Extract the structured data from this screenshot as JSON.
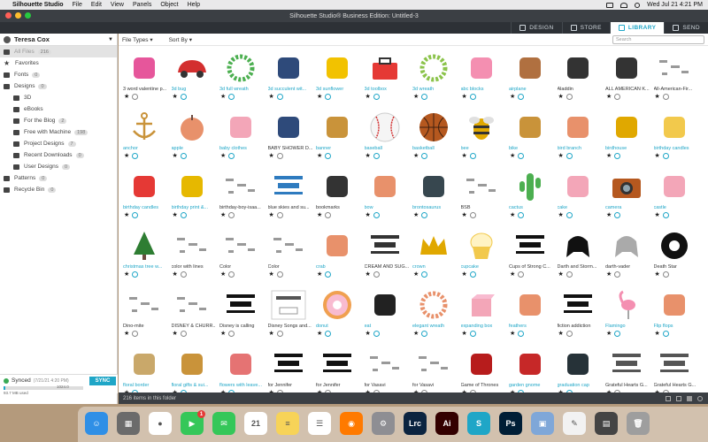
{
  "menubar": {
    "app_name": "Silhouette Studio",
    "items": [
      "File",
      "Edit",
      "View",
      "Panels",
      "Object",
      "Help"
    ],
    "clock": "Wed Jul 21  4:21 PM"
  },
  "window": {
    "title": "Silhouette Studio® Business Edition: Untitled-3"
  },
  "tabs": [
    {
      "label": "DESIGN",
      "active": false,
      "icon": "design-icon"
    },
    {
      "label": "STORE",
      "active": false,
      "icon": "store-icon"
    },
    {
      "label": "LIBRARY",
      "active": true,
      "icon": "library-icon"
    },
    {
      "label": "SEND",
      "active": false,
      "icon": "send-icon"
    }
  ],
  "sidebar": {
    "user": "Teresa Cox",
    "items": [
      {
        "label": "All Files",
        "count": "216",
        "indent": false,
        "selected": true,
        "icon": "grid-icon"
      },
      {
        "label": "Favorites",
        "count": "",
        "indent": false,
        "selected": false,
        "icon": "star-icon"
      },
      {
        "label": "Fonts",
        "count": "0",
        "indent": false,
        "selected": false,
        "icon": "font-icon"
      },
      {
        "label": "Designs",
        "count": "0",
        "indent": false,
        "selected": false,
        "icon": "folder-icon"
      },
      {
        "label": "3D",
        "count": "",
        "indent": true,
        "selected": false,
        "icon": "folder-icon"
      },
      {
        "label": "eBooks",
        "count": "",
        "indent": true,
        "selected": false,
        "icon": "folder-icon"
      },
      {
        "label": "For the Blog",
        "count": "2",
        "indent": true,
        "selected": false,
        "icon": "folder-icon"
      },
      {
        "label": "Free with Machine",
        "count": "198",
        "indent": true,
        "selected": false,
        "icon": "folder-icon"
      },
      {
        "label": "Project Designs",
        "count": "7",
        "indent": true,
        "selected": false,
        "icon": "folder-icon"
      },
      {
        "label": "Recent Downloads",
        "count": "0",
        "indent": true,
        "selected": false,
        "icon": "folder-icon"
      },
      {
        "label": "User Designs",
        "count": "0",
        "indent": true,
        "selected": false,
        "icon": "folder-icon"
      },
      {
        "label": "Patterns",
        "count": "0",
        "indent": false,
        "selected": false,
        "icon": "pattern-icon"
      },
      {
        "label": "Recycle Bin",
        "count": "0",
        "indent": false,
        "selected": false,
        "icon": "trash-icon"
      }
    ],
    "sync": {
      "status": "Synced",
      "when": "(7/21/21 4:20 PM)",
      "used_fraction": 0.02,
      "used_text": "93.7 MB used",
      "capacity": "1024.0",
      "button": "SYNC"
    }
  },
  "library": {
    "file_types_label": "File Types",
    "sort_by_label": "Sort By",
    "search_placeholder": "Search",
    "footer": "216 items in this folder",
    "rows": [
      [
        {
          "label": "3 word valentine p...",
          "cloud": false,
          "icon": "valentine-words-icon",
          "color": "#e6569b"
        },
        {
          "label": "3d bug",
          "cloud": true,
          "icon": "car-icon",
          "color": "#d32f2f"
        },
        {
          "label": "3d full wreath",
          "cloud": true,
          "icon": "wreath-icon",
          "color": "#4caf50"
        },
        {
          "label": "3d succulent wit...",
          "cloud": true,
          "icon": "succulent-icon",
          "color": "#2e4a7a"
        },
        {
          "label": "3d sunflower",
          "cloud": true,
          "icon": "sunflower-icon",
          "color": "#f2c200"
        },
        {
          "label": "3d toolbox",
          "cloud": true,
          "icon": "toolbox-icon",
          "color": "#e53935"
        },
        {
          "label": "3d wreath",
          "cloud": true,
          "icon": "wreath-icon",
          "color": "#8bc34a"
        },
        {
          "label": "abc blocks",
          "cloud": true,
          "icon": "blocks-icon",
          "color": "#f48fb1"
        },
        {
          "label": "airplane",
          "cloud": true,
          "icon": "airplane-icon",
          "color": "#b07040"
        },
        {
          "label": "Aladdin",
          "cloud": false,
          "icon": "globe-icon",
          "color": "#333333"
        },
        {
          "label": "ALL AMERICAN K...",
          "cloud": false,
          "icon": "splash-icon",
          "color": "#333333"
        },
        {
          "label": "All-American-Fir...",
          "cloud": false,
          "icon": "sketch-icon",
          "color": "#999999"
        }
      ],
      [
        {
          "label": "anchor",
          "cloud": true,
          "icon": "anchor-icon",
          "color": "#c9933a"
        },
        {
          "label": "apple",
          "cloud": true,
          "icon": "apple-icon",
          "color": "#e8916b"
        },
        {
          "label": "baby clothes",
          "cloud": true,
          "icon": "onesie-icon",
          "color": "#f3a6b8"
        },
        {
          "label": "BABY SHOWER D...",
          "cloud": false,
          "icon": "flag-icon",
          "color": "#2e4a7a"
        },
        {
          "label": "banner",
          "cloud": true,
          "icon": "banner-icon",
          "color": "#c9933a"
        },
        {
          "label": "baseball",
          "cloud": true,
          "icon": "baseball-icon",
          "color": "#d32f2f"
        },
        {
          "label": "basketball",
          "cloud": true,
          "icon": "basketball-icon",
          "color": "#b5581f"
        },
        {
          "label": "bee",
          "cloud": true,
          "icon": "bee-icon",
          "color": "#e0a800"
        },
        {
          "label": "bike",
          "cloud": true,
          "icon": "bike-icon",
          "color": "#c9933a"
        },
        {
          "label": "bird branch",
          "cloud": true,
          "icon": "branch-icon",
          "color": "#e8916b"
        },
        {
          "label": "birdhouse",
          "cloud": true,
          "icon": "birdhouse-icon",
          "color": "#e0a800"
        },
        {
          "label": "birthday candles",
          "cloud": true,
          "icon": "box-icon",
          "color": "#f2c94c"
        }
      ],
      [
        {
          "label": "birthday candles",
          "cloud": true,
          "icon": "candles-icon",
          "color": "#e53935"
        },
        {
          "label": "birthday print &...",
          "cloud": true,
          "icon": "girl-icon",
          "color": "#e6b800"
        },
        {
          "label": "birthday-boy-isaa...",
          "cloud": false,
          "icon": "sketch-icon",
          "color": "#999999"
        },
        {
          "label": "blue skies and su...",
          "cloud": false,
          "icon": "text-art-icon",
          "color": "#2e7bbf"
        },
        {
          "label": "bookmarks",
          "cloud": false,
          "icon": "bookmark-icon",
          "color": "#333333"
        },
        {
          "label": "bow",
          "cloud": true,
          "icon": "bow-icon",
          "color": "#e8916b"
        },
        {
          "label": "brontosaurus",
          "cloud": true,
          "icon": "dinosaur-icon",
          "color": "#37474f"
        },
        {
          "label": "BSB",
          "cloud": false,
          "icon": "sketch-icon",
          "color": "#999999"
        },
        {
          "label": "cactus",
          "cloud": true,
          "icon": "cactus-icon",
          "color": "#4caf50"
        },
        {
          "label": "cake",
          "cloud": true,
          "icon": "cake-icon",
          "color": "#f3a6b8"
        },
        {
          "label": "camera",
          "cloud": true,
          "icon": "camera-icon",
          "color": "#b5581f"
        },
        {
          "label": "castle",
          "cloud": true,
          "icon": "castle-icon",
          "color": "#f3a6b8"
        }
      ],
      [
        {
          "label": "christmas tree w...",
          "cloud": true,
          "icon": "tree-icon",
          "color": "#2e7d32"
        },
        {
          "label": "color with lines",
          "cloud": false,
          "icon": "sketch-icon",
          "color": "#999999"
        },
        {
          "label": "Color",
          "cloud": false,
          "icon": "sketch-icon",
          "color": "#999999"
        },
        {
          "label": "Color",
          "cloud": false,
          "icon": "sketch-icon",
          "color": "#999999"
        },
        {
          "label": "crab",
          "cloud": true,
          "icon": "crab-icon",
          "color": "#e8916b"
        },
        {
          "label": "CREAM AND SUG...",
          "cloud": false,
          "icon": "text-art-icon",
          "color": "#333333"
        },
        {
          "label": "crown",
          "cloud": true,
          "icon": "crown-icon",
          "color": "#e0a800"
        },
        {
          "label": "cupcake",
          "cloud": true,
          "icon": "cupcake-icon",
          "color": "#f2c94c"
        },
        {
          "label": "Cups of Strong C...",
          "cloud": false,
          "icon": "text-art-icon",
          "color": "#111111"
        },
        {
          "label": "Darth and Storm...",
          "cloud": false,
          "icon": "helmet-icon",
          "color": "#111111"
        },
        {
          "label": "darth-vader",
          "cloud": false,
          "icon": "helmet-icon",
          "color": "#aaaaaa"
        },
        {
          "label": "Death Star",
          "cloud": false,
          "icon": "emblem-icon",
          "color": "#111111"
        }
      ],
      [
        {
          "label": "Dino-mite",
          "cloud": false,
          "icon": "sketch-icon",
          "color": "#999999"
        },
        {
          "label": "DISNEY & CHURR...",
          "cloud": false,
          "icon": "sketch-icon",
          "color": "#999999"
        },
        {
          "label": "Disney is calling",
          "cloud": false,
          "icon": "text-art-icon",
          "color": "#111111"
        },
        {
          "label": "Disney Songs and...",
          "cloud": false,
          "icon": "download-failed-icon",
          "color": "#555555"
        },
        {
          "label": "donut",
          "cloud": true,
          "icon": "donut-icon",
          "color": "#f0a050"
        },
        {
          "label": "eat",
          "cloud": true,
          "icon": "utensils-icon",
          "color": "#222222"
        },
        {
          "label": "elegant wreath",
          "cloud": true,
          "icon": "wreath-icon",
          "color": "#e8916b"
        },
        {
          "label": "expanding box",
          "cloud": true,
          "icon": "gift-box-icon",
          "color": "#f3a6b8"
        },
        {
          "label": "feathers",
          "cloud": true,
          "icon": "feather-icon",
          "color": "#e8916b"
        },
        {
          "label": "fiction addiction",
          "cloud": false,
          "icon": "text-art-icon",
          "color": "#111111"
        },
        {
          "label": "Flamingo",
          "cloud": true,
          "icon": "flamingo-icon",
          "color": "#f48fb1"
        },
        {
          "label": "Flip flops",
          "cloud": true,
          "icon": "flipflops-icon",
          "color": "#e8916b"
        }
      ],
      [
        {
          "label": "floral border",
          "cloud": true,
          "icon": "border-icon",
          "color": "#c9a86a"
        },
        {
          "label": "floral gifts & sui...",
          "cloud": true,
          "icon": "gifts-icon",
          "color": "#c9933a"
        },
        {
          "label": "flowers with leave...",
          "cloud": true,
          "icon": "flowers-icon",
          "color": "#e57373"
        },
        {
          "label": "for Jennifer",
          "cloud": false,
          "icon": "text-art-icon",
          "color": "#111111"
        },
        {
          "label": "for Jennifer",
          "cloud": false,
          "icon": "text-art-icon",
          "color": "#111111"
        },
        {
          "label": "for Vasavi",
          "cloud": false,
          "icon": "sketch-icon",
          "color": "#999999"
        },
        {
          "label": "for Vasavi",
          "cloud": false,
          "icon": "sketch-icon",
          "color": "#999999"
        },
        {
          "label": "Game of Thrones",
          "cloud": false,
          "icon": "flag-icon",
          "color": "#b71c1c"
        },
        {
          "label": "garden gnome",
          "cloud": true,
          "icon": "gnome-icon",
          "color": "#c62828"
        },
        {
          "label": "graduation cap",
          "cloud": true,
          "icon": "cap-icon",
          "color": "#263238"
        },
        {
          "label": "Grateful Hearts G...",
          "cloud": false,
          "icon": "text-art-icon",
          "color": "#555555"
        },
        {
          "label": "Grateful Hearts G...",
          "cloud": false,
          "icon": "text-art-icon",
          "color": "#555555"
        }
      ]
    ]
  },
  "dock": [
    {
      "name": "finder",
      "bg": "#2f8fe6",
      "glyph": "☺",
      "badge": ""
    },
    {
      "name": "launchpad",
      "bg": "#6b6b6b",
      "glyph": "▦",
      "badge": ""
    },
    {
      "name": "chrome",
      "bg": "#ffffff",
      "glyph": "●",
      "badge": ""
    },
    {
      "name": "facetime",
      "bg": "#35c759",
      "glyph": "▶",
      "badge": "1"
    },
    {
      "name": "messages",
      "bg": "#35c759",
      "glyph": "✉",
      "badge": ""
    },
    {
      "name": "calendar",
      "bg": "#ffffff",
      "glyph": "21",
      "badge": ""
    },
    {
      "name": "notes",
      "bg": "#f7d358",
      "glyph": "≡",
      "badge": ""
    },
    {
      "name": "reminders",
      "bg": "#ffffff",
      "glyph": "☰",
      "badge": ""
    },
    {
      "name": "brave",
      "bg": "#ff7a00",
      "glyph": "◉",
      "badge": ""
    },
    {
      "name": "system-preferences",
      "bg": "#8e8e93",
      "glyph": "⚙",
      "badge": ""
    },
    {
      "name": "lightroom",
      "bg": "#0b2440",
      "glyph": "Lrc",
      "badge": ""
    },
    {
      "name": "illustrator",
      "bg": "#330000",
      "glyph": "Ai",
      "badge": ""
    },
    {
      "name": "silhouette",
      "bg": "#1fa6c7",
      "glyph": "S",
      "badge": ""
    },
    {
      "name": "photoshop",
      "bg": "#001e36",
      "glyph": "Ps",
      "badge": ""
    },
    {
      "name": "preview",
      "bg": "#7fa7d8",
      "glyph": "▣",
      "badge": ""
    },
    {
      "name": "textedit",
      "bg": "#f2f2f2",
      "glyph": "✎",
      "badge": ""
    },
    {
      "name": "downloads",
      "bg": "#444444",
      "glyph": "▤",
      "badge": ""
    },
    {
      "name": "trash",
      "bg": "#9e9e9e",
      "glyph": "🗑",
      "badge": ""
    }
  ]
}
